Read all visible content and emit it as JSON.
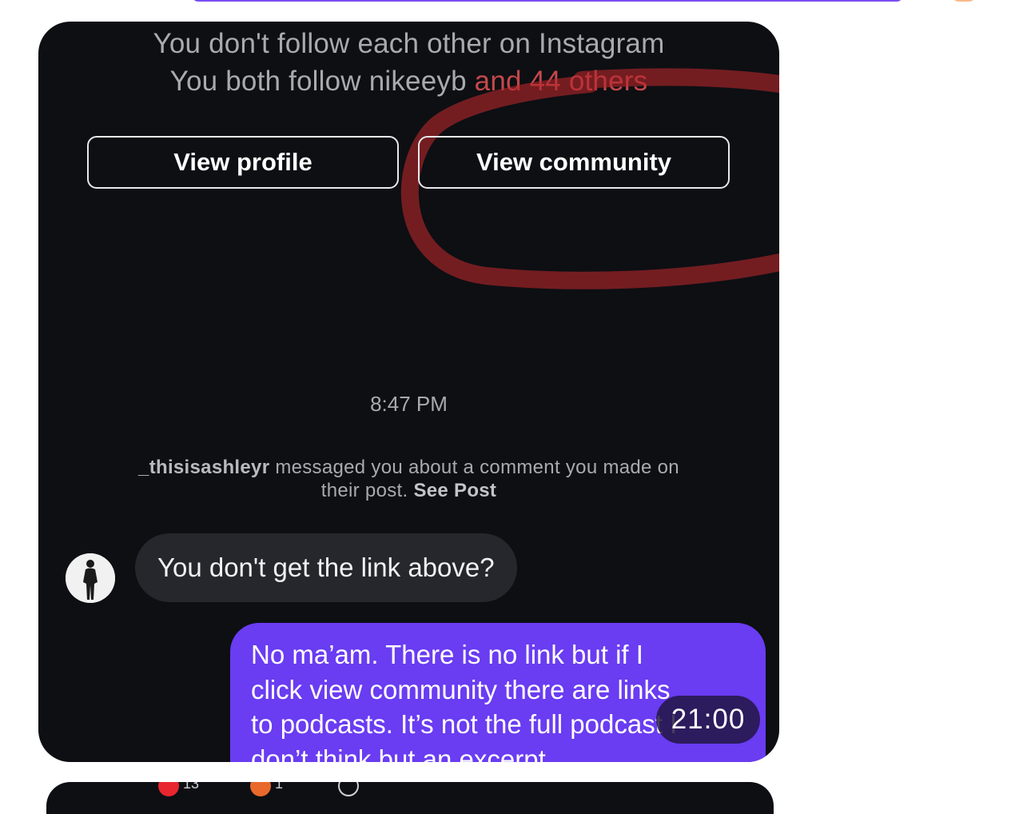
{
  "header": {
    "follow_status": "You don't follow each other on Instagram",
    "mutual_prefix": "You both follow nikeeyb",
    "mutual_suffix": "and 44 others"
  },
  "buttons": {
    "view_profile": "View profile",
    "view_community": "View community"
  },
  "thread": {
    "timestamp": "8:47 PM",
    "notice": {
      "username": "_thisisashleyr",
      "text": "messaged you about a comment you made on their post.",
      "link": "See Post"
    },
    "incoming_message": "You don't get the link above?",
    "outgoing_message": {
      "lines": [
        "No ma’am. There is no link but if I",
        "click view community there are links",
        "to podcasts. It’s not the full podcast I",
        "don’t think but an excerpt"
      ]
    },
    "video_time": "21:00"
  },
  "reactions": [
    {
      "icon": "heart-icon",
      "count": "13"
    },
    {
      "icon": "angry-face-icon",
      "count": "1"
    }
  ],
  "colors": {
    "card_bg": "#0d0f13",
    "outgoing_bubble": "#6a3cf2",
    "incoming_bubble": "#25272d",
    "annotation_red": "#c4484b"
  }
}
